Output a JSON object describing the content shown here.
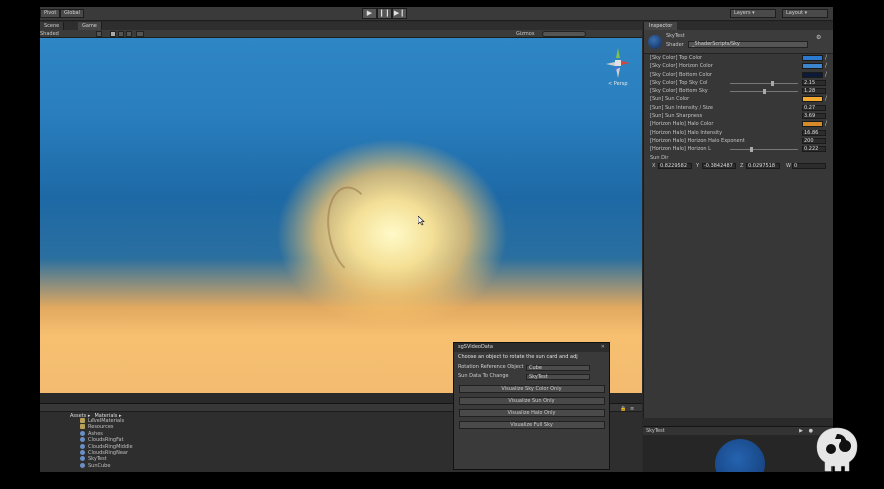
{
  "toolbar": {
    "pivot_label": "Pivot",
    "global_label": "Global",
    "play_icon": "▶",
    "pause_icon": "❙❙",
    "step_icon": "▶❙",
    "layers_label": "Layers",
    "layout_label": "Layout"
  },
  "tabs": {
    "scene": "Scene",
    "game": "Game"
  },
  "game_subbar": {
    "shaded": "Shaded",
    "gizmos": "Gizmos"
  },
  "scene_gizmo": {
    "persp_label": "< Persp"
  },
  "inspector": {
    "tab_label": "Inspector",
    "material_name": "SkyTest",
    "shader_label": "Shader",
    "shader_value": "_ShaderScripts/Sky",
    "properties": [
      {
        "label": "[Sky Color] Top Color",
        "kind": "color",
        "color": "#2a7bd0"
      },
      {
        "label": "[Sky Color] Horizon Color",
        "kind": "color",
        "color": "#3c86d0"
      },
      {
        "label": "[Sky Color] Bottom Color",
        "kind": "color",
        "color": "#0c1a3a"
      },
      {
        "label": "[Sky Color] Top Sky Col",
        "kind": "slider",
        "value": "2.15",
        "fill": 0.62
      },
      {
        "label": "[Sky Color] Bottom Sky",
        "kind": "slider",
        "value": "1.28",
        "fill": 0.5
      },
      {
        "label": "[Sun] Sun Color",
        "kind": "color",
        "color": "#f0a830"
      },
      {
        "label": "[Sun] Sun Intensity / Size",
        "kind": "value",
        "value": "0.27"
      },
      {
        "label": "[Sun] Sun Sharpness",
        "kind": "value",
        "value": "3.69"
      },
      {
        "label": "[Horizon Halo] Halo Color",
        "kind": "color",
        "color": "#d88a28"
      },
      {
        "label": "[Horizon Halo] Halo Intensity",
        "kind": "value",
        "value": "16.86"
      },
      {
        "label": "[Horizon Halo] Horizon Halo Exponent",
        "kind": "value",
        "value": "200"
      },
      {
        "label": "[Horizon Halo] Horizon L",
        "kind": "slider",
        "value": "0.222",
        "fill": 0.3
      }
    ],
    "sun_dir_label": "Sun Dir",
    "sun_dir": {
      "x_label": "X",
      "x": "0.8229582",
      "y_label": "Y",
      "y": "-0.3842487",
      "z_label": "Z",
      "z": "0.0297518",
      "w_label": "W",
      "w": "0"
    }
  },
  "preview": {
    "title": "SkyTest"
  },
  "project": {
    "breadcrumb": "Assets ▸ _Materials ▸",
    "items": [
      {
        "name": "LevelMaterials",
        "kind": "folder"
      },
      {
        "name": "Resources",
        "kind": "folder"
      },
      {
        "name": "Ashes",
        "kind": "material"
      },
      {
        "name": "CloudsRingFat",
        "kind": "material"
      },
      {
        "name": "CloudsRingMiddle",
        "kind": "material"
      },
      {
        "name": "CloudsRingNear",
        "kind": "material"
      },
      {
        "name": "SkyTest",
        "kind": "material"
      },
      {
        "name": "SunCube",
        "kind": "material"
      }
    ]
  },
  "sgs_window": {
    "title": "sgSVideoData",
    "description": "Choose an object to rotate the sun card and adj",
    "rotation_label": "Rotation Reference Object",
    "rotation_value": "Cube",
    "sun_data_label": "Sun Data To Change",
    "sun_data_value": "SkyTest",
    "buttons": [
      "Visualize Sky Color Only",
      "Visualize Sun Only",
      "Visualize Halo Only",
      "Visualize Full Sky"
    ]
  }
}
